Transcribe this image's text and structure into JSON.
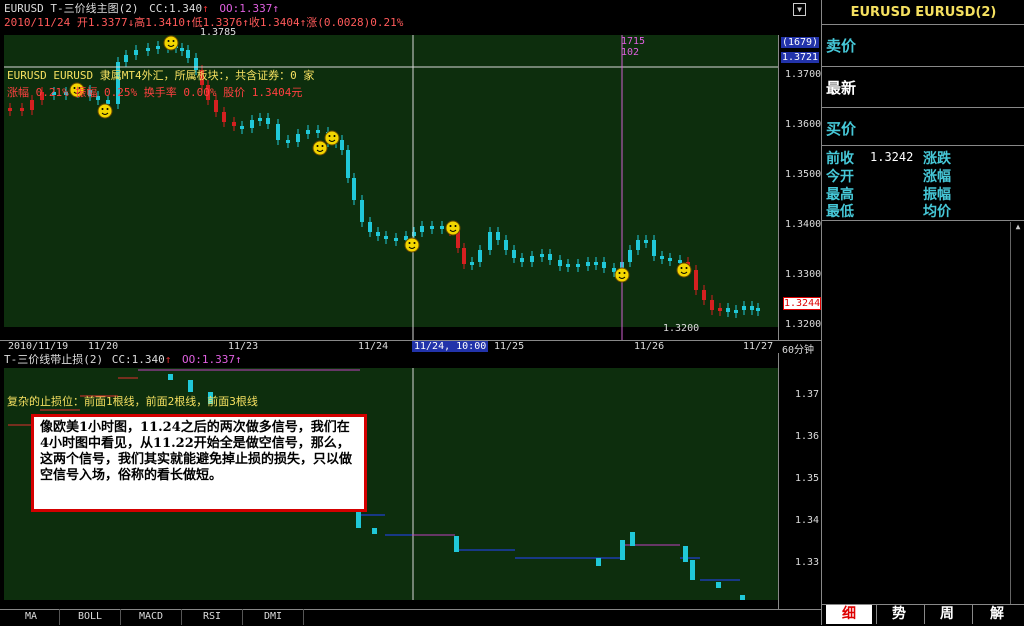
{
  "top_panel": {
    "title_left": "EURUSD T-三价线主图(2)",
    "cc_label": "CC:1.340",
    "cc_arrow": "↑",
    "oo_label": "OO:1.337",
    "oo_arrow": "↑",
    "info_line": "2010/11/24 开1.3377↓高1.3410↑低1.3376↑收1.3404↑涨(0.0028)0.21%",
    "overlay_line1": "EURUSD EURUSD 隶属MT4外汇，所属板块：，共含证券：0 家",
    "overlay_line2": "涨幅 0.21% 振幅 0.25% 换手率 0.00% 股价 1.3404元",
    "price_labels": [
      "1.3700",
      "1.3600",
      "1.3500",
      "1.3400",
      "1.3300",
      "1.3200"
    ],
    "badge_top": "(1679)",
    "badge_price": "1.3721",
    "current_price": "1.3244",
    "crosshair_top_a": "1715",
    "crosshair_top_b": "102",
    "high_marker": "1.3785",
    "low_marker": "1.3200"
  },
  "date_axis": {
    "labels": [
      "2010/11/19",
      "11/20",
      "11/23",
      "11/24",
      "11/24, 10:00",
      "11/25",
      "11/26",
      "11/27"
    ],
    "period": "60分钟"
  },
  "bottom_panel": {
    "title": "T-三价线带止损(2)",
    "cc_label": "CC:1.340",
    "cc_arrow": "↑",
    "oo_label": "OO:1.337",
    "oo_arrow": "↑",
    "stop_line": "复杂的止损位：前面1根线，前面2根线，前面3根线",
    "price_labels": [
      "1.37",
      "1.36",
      "1.35",
      "1.34",
      "1.33"
    ]
  },
  "annotation": {
    "text": "像欧美1小时图，11.24之后的两次做多信号，我们在4小时图中看见，从11.22开始全是做空信号，那么，这两个信号，我们其实就能避免掉止损的损失，只以做空信号入场，俗称的看长做短。"
  },
  "indicator_tabs": [
    "MA",
    "BOLL",
    "MACD",
    "RSI",
    "DMI"
  ],
  "quote_panel": {
    "symbol": "EURUSD EURUSD(2)",
    "sell_label": "卖价",
    "latest_label": "最新",
    "buy_label": "买价",
    "prev_close_label": "前收",
    "prev_close_value": "1.3242",
    "change_label": "涨跌",
    "open_label": "今开",
    "change_pct_label": "涨幅",
    "high_label": "最高",
    "amplitude_label": "振幅",
    "low_label": "最低",
    "avg_label": "均价",
    "bottom_tabs": [
      "细",
      "势",
      "周",
      "解"
    ]
  },
  "colors": {
    "pane_bg": "#0d2e0d",
    "up_candle": "#d42020",
    "down_candle": "#20c8d8",
    "accent_cyan": "#46c8d8",
    "annotation_border": "#d40000"
  }
}
